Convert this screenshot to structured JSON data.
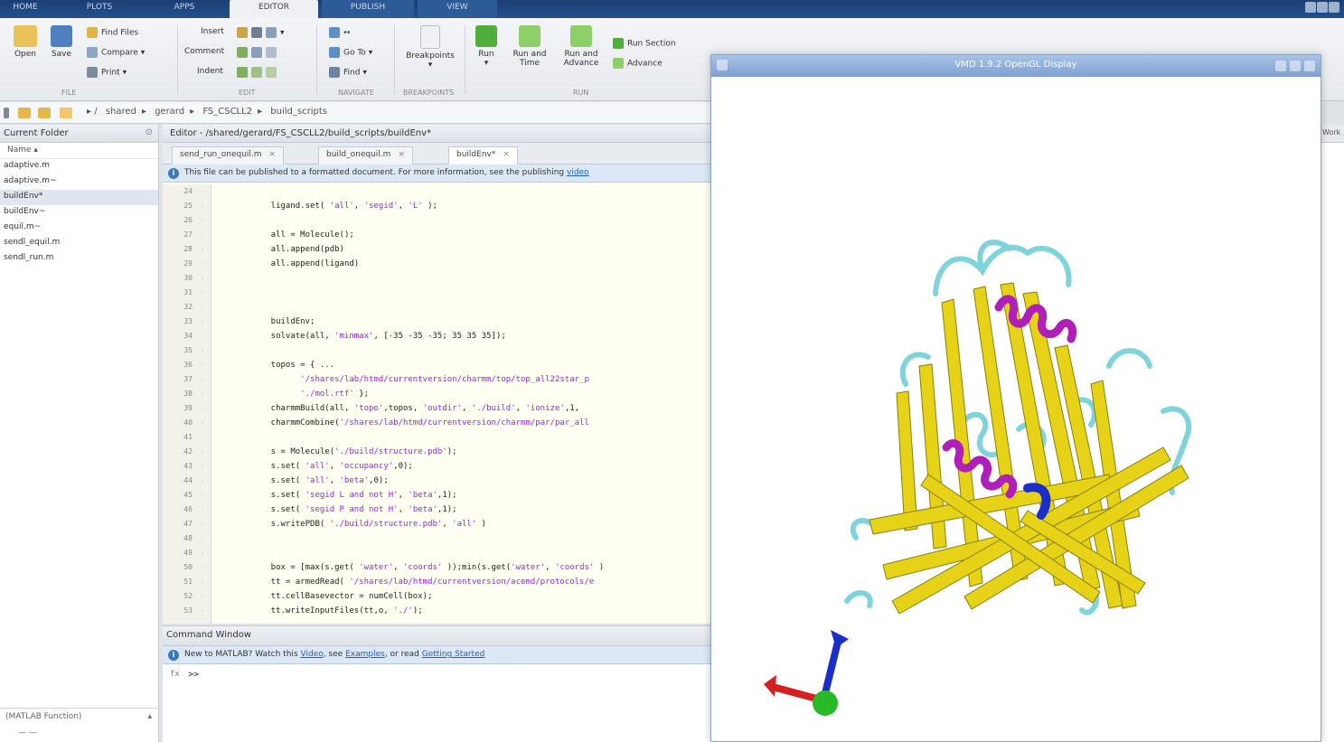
{
  "toolstrip": {
    "tabs": [
      "HOME",
      "PLOTS",
      "APPS",
      "EDITOR",
      "PUBLISH",
      "VIEW"
    ],
    "active_tab": "EDITOR"
  },
  "ribbon": {
    "open": "Open",
    "save": "Save",
    "find_files": "Find Files",
    "compare": "Compare",
    "print": "Print",
    "insert": "Insert",
    "comment": "Comment",
    "indent": "Indent",
    "go_to": "Go To",
    "find": "Find",
    "breakpoints": "Breakpoints",
    "run": "Run",
    "run_and_time": "Run and Time",
    "run_and_advance": "Run and Advance",
    "run_section": "Run Section",
    "advance": "Advance",
    "groups": [
      "FILE",
      "EDIT",
      "NAVIGATE",
      "BREAKPOINTS",
      "RUN"
    ]
  },
  "address": {
    "crumbs": [
      "shared",
      "gerard",
      "FS_CSCLL2",
      "build_scripts"
    ]
  },
  "current_folder": {
    "title": "Current Folder",
    "column": "Name",
    "files": [
      "adaptive.m",
      "adaptive.m~",
      "buildEnv*",
      "buildEnv~",
      "equil.m~",
      "sendl_equil.m",
      "sendl_run.m"
    ],
    "selected_index": 2,
    "footer": "(MATLAB Function)"
  },
  "editor": {
    "title": "Editor - /shared/gerard/FS_CSCLL2/build_scripts/buildEnv*",
    "tabs": [
      "send_run_onequil.m",
      "build_onequil.m",
      "buildEnv*"
    ],
    "info": "This file can be published to a formatted document. For more information, see the publishing",
    "info_link": "video",
    "line_numbers": [
      "24",
      "25",
      "26",
      "27",
      "28",
      "29",
      "30",
      "31",
      "32",
      "33",
      "34",
      "35",
      "36",
      "37",
      "38",
      "39",
      "40",
      "41",
      "42",
      "43",
      "44",
      "45",
      "46",
      "47",
      "48",
      "49",
      "50",
      "51",
      "52",
      "53"
    ],
    "lines": [
      [
        "",
        ""
      ],
      [
        "    ligand.set( ",
        "'all'",
        ", ",
        "'segid'",
        ", ",
        "'L'",
        " );"
      ],
      [
        "",
        ""
      ],
      [
        "    all = Molecule();",
        ""
      ],
      [
        "    all.append(pdb)",
        ""
      ],
      [
        "    all.append(ligand)",
        ""
      ],
      [
        "",
        ""
      ],
      [
        "",
        ""
      ],
      [
        "",
        ""
      ],
      [
        "    buildEnv;",
        ""
      ],
      [
        "    solvate(all, ",
        "'minmax'",
        ", [-35 -35 -35; 35 35 35]);",
        ""
      ],
      [
        "",
        ""
      ],
      [
        "    topos = { ...",
        ""
      ],
      [
        "          ",
        "'/shares/lab/htmd/currentversion/charmm/top/top_all22star_p",
        ""
      ],
      [
        "          ",
        "'./mol.rtf'",
        " };"
      ],
      [
        "    charmmBuild(all, ",
        "'topo'",
        ",topos, ",
        "'outdir'",
        ", ",
        "'./build'",
        ", ",
        "'ionize'",
        ",1,"
      ],
      [
        "    charmmCombine(",
        "'/shares/lab/htmd/currentversion/charmm/par/par_all",
        ""
      ],
      [
        "",
        ""
      ],
      [
        "    s = Molecule(",
        "'./build/structure.pdb'",
        ");"
      ],
      [
        "    s.set( ",
        "'all'",
        ", ",
        "'occupancy'",
        ",0);"
      ],
      [
        "    s.set( ",
        "'all'",
        ", ",
        "'beta'",
        ",0);"
      ],
      [
        "    s.set( ",
        "'segid L and not H'",
        ", ",
        "'beta'",
        ",1);"
      ],
      [
        "    s.set( ",
        "'segid P and not H'",
        ", ",
        "'beta'",
        ",1);"
      ],
      [
        "    s.writePDB( ",
        "'./build/structure.pdb'",
        ", ",
        "'all'",
        " )"
      ],
      [
        "",
        ""
      ],
      [
        "",
        ""
      ],
      [
        "    box = [max(s.get( ",
        "'water'",
        ", ",
        "'coords'",
        " ));min(s.get(",
        "'water'",
        ", ",
        "'coords'",
        " )"
      ],
      [
        "    tt = armedRead( ",
        "'/shares/lab/htmd/currentversion/acemd/protocols/e",
        ""
      ],
      [
        "    tt.cellBasevector = numCell(box);",
        ""
      ],
      [
        "    tt.writeInputFiles(tt,o, ",
        "'./'",
        ");"
      ]
    ]
  },
  "command_window": {
    "title": "Command Window",
    "info_prefix": "New to MATLAB? Watch this",
    "video": "Video",
    "see": ", see",
    "examples": "Examples",
    "or_read": ", or read",
    "getting_started": "Getting Started",
    "prompt": ">>"
  },
  "vmd": {
    "title": "VMD 1.9.2 OpenGL Display"
  }
}
